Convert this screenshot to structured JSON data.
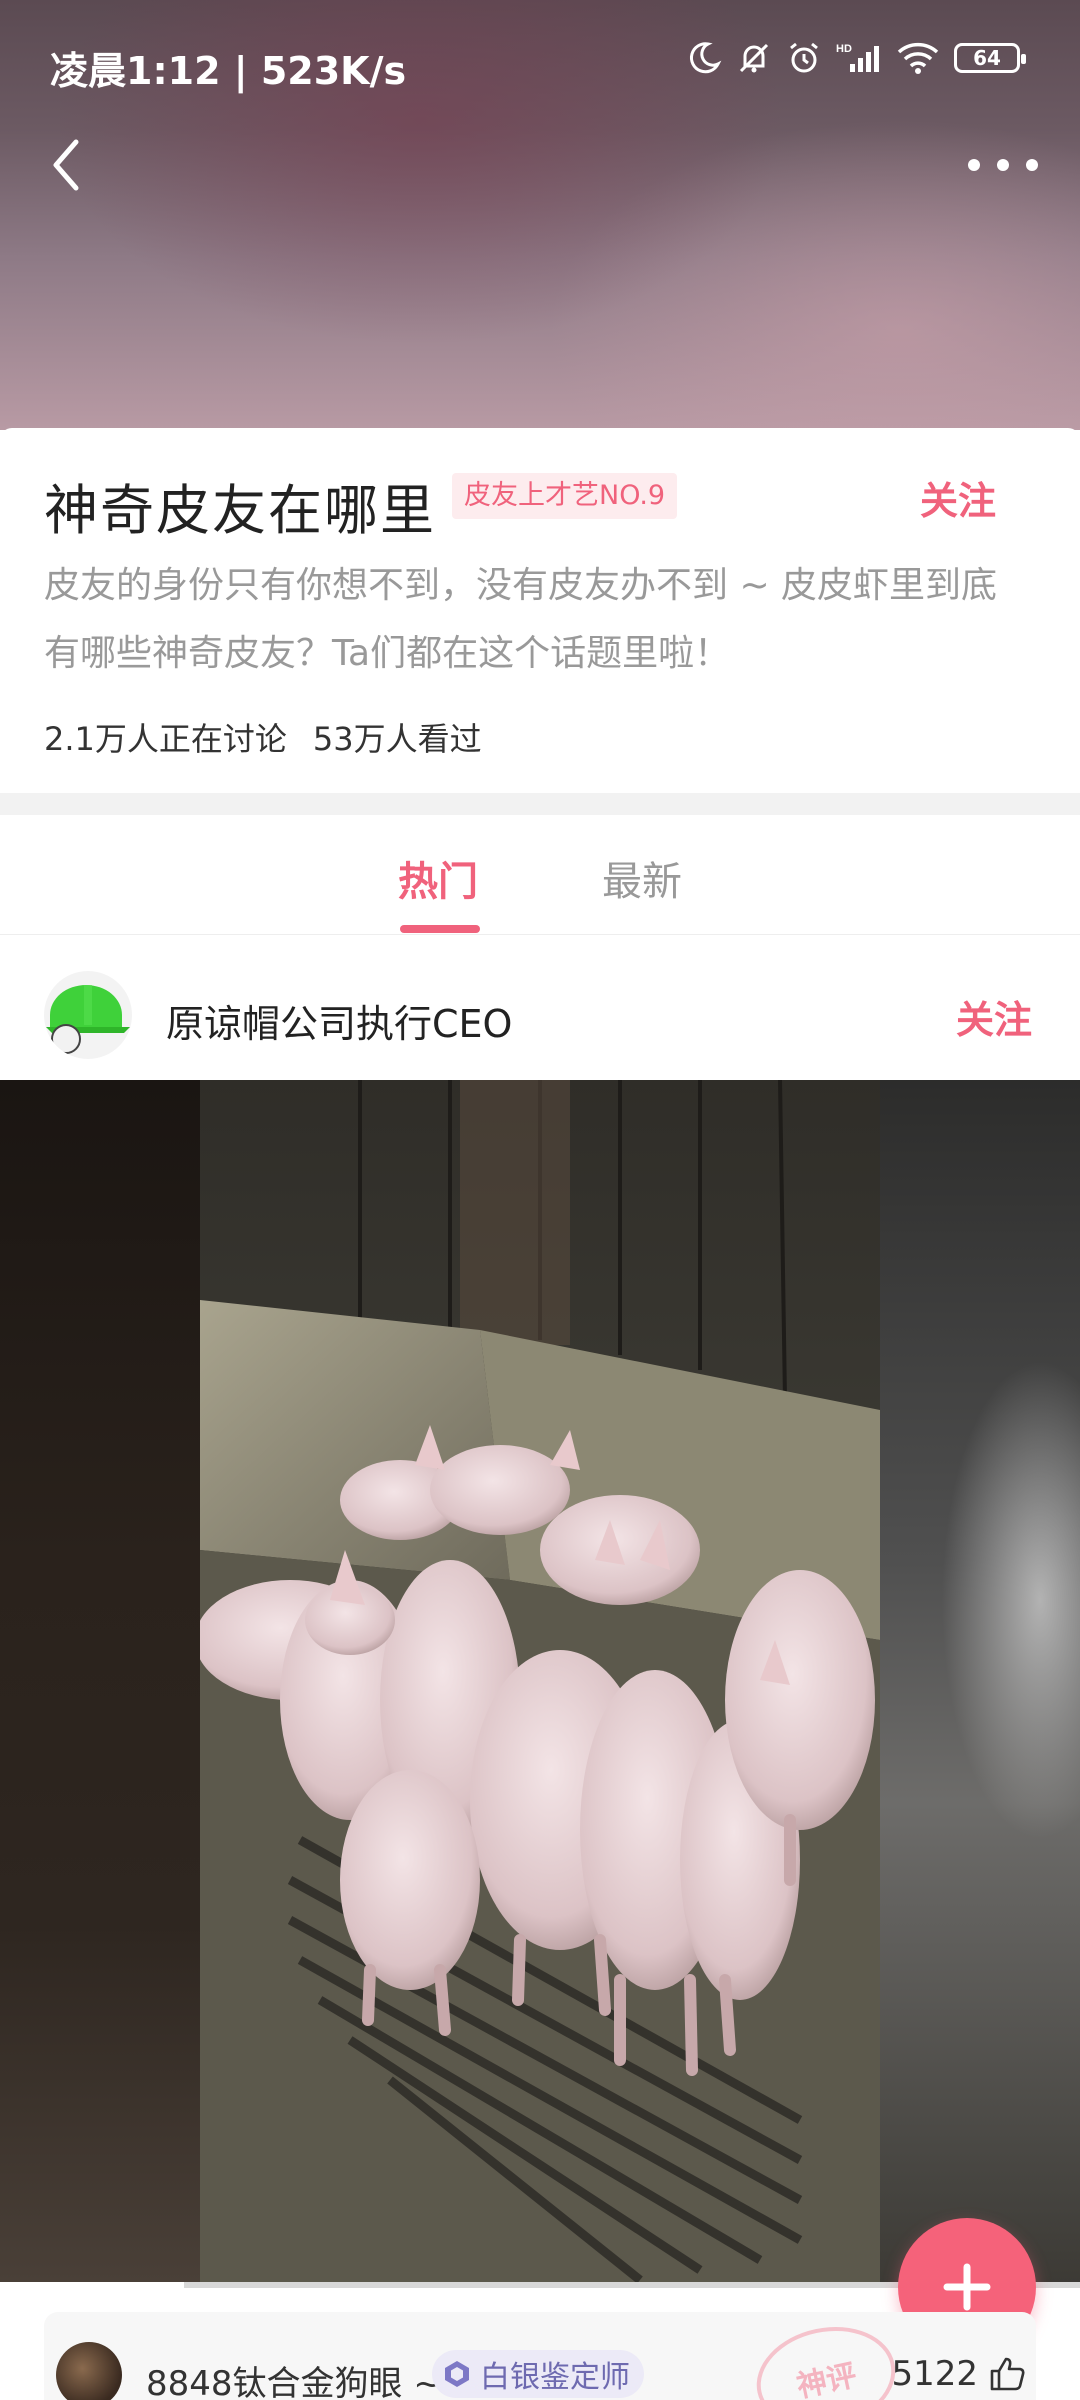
{
  "status_bar": {
    "time": "凌晨1:12 | 523K/s",
    "battery": "64"
  },
  "topic": {
    "title": "神奇皮友在哪里",
    "tag": "皮友上才艺NO.9",
    "follow_label": "关注",
    "description": "皮友的身份只有你想不到，没有皮友办不到 ~ 皮皮虾里到底有哪些神奇皮友？Ta们都在这个话题里啦！",
    "discussing": "2.1万人正在讨论",
    "viewed": "53万人看过"
  },
  "tabs": {
    "hot": "热门",
    "new": "最新",
    "active": "hot"
  },
  "post": {
    "author": "原谅帽公司执行CEO",
    "follow_label": "关注",
    "video_progress": 0.17
  },
  "comment": {
    "user": "8848钛合金狗眼 ~",
    "badge": "白银鉴定师",
    "stamp": "神评",
    "likes": "5122"
  },
  "colors": {
    "accent": "#f0627c",
    "helmet": "#3fd13a"
  }
}
